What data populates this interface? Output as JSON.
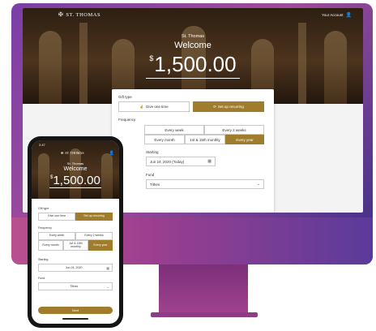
{
  "brand": {
    "name": "ST. THOMAS"
  },
  "account": {
    "label": "Your Account"
  },
  "hero": {
    "church_name": "St. Thomas",
    "welcome": "Welcome",
    "currency": "$",
    "amount": "1,500.00"
  },
  "form": {
    "gift_type_label": "Gift type",
    "give_one_time": "Give one time",
    "set_up_recurring": "Set up recurring",
    "frequency_label": "Frequency",
    "freq_every_week": "Every week",
    "freq_every_2_weeks": "Every 2 weeks",
    "freq_every_month": "Every month",
    "freq_1st_15th": "1st & 15th monthly",
    "freq_every_year": "Every year",
    "starting_label": "Starting",
    "starting_value": "Jun 24, 2020 (Today)",
    "fund_label": "Fund",
    "fund_value": "Tithes"
  },
  "phone": {
    "status_time": "2:47",
    "starting_value": "Jun 24, 2020",
    "next": "Next"
  },
  "colors": {
    "accent": "#a07d2d"
  }
}
